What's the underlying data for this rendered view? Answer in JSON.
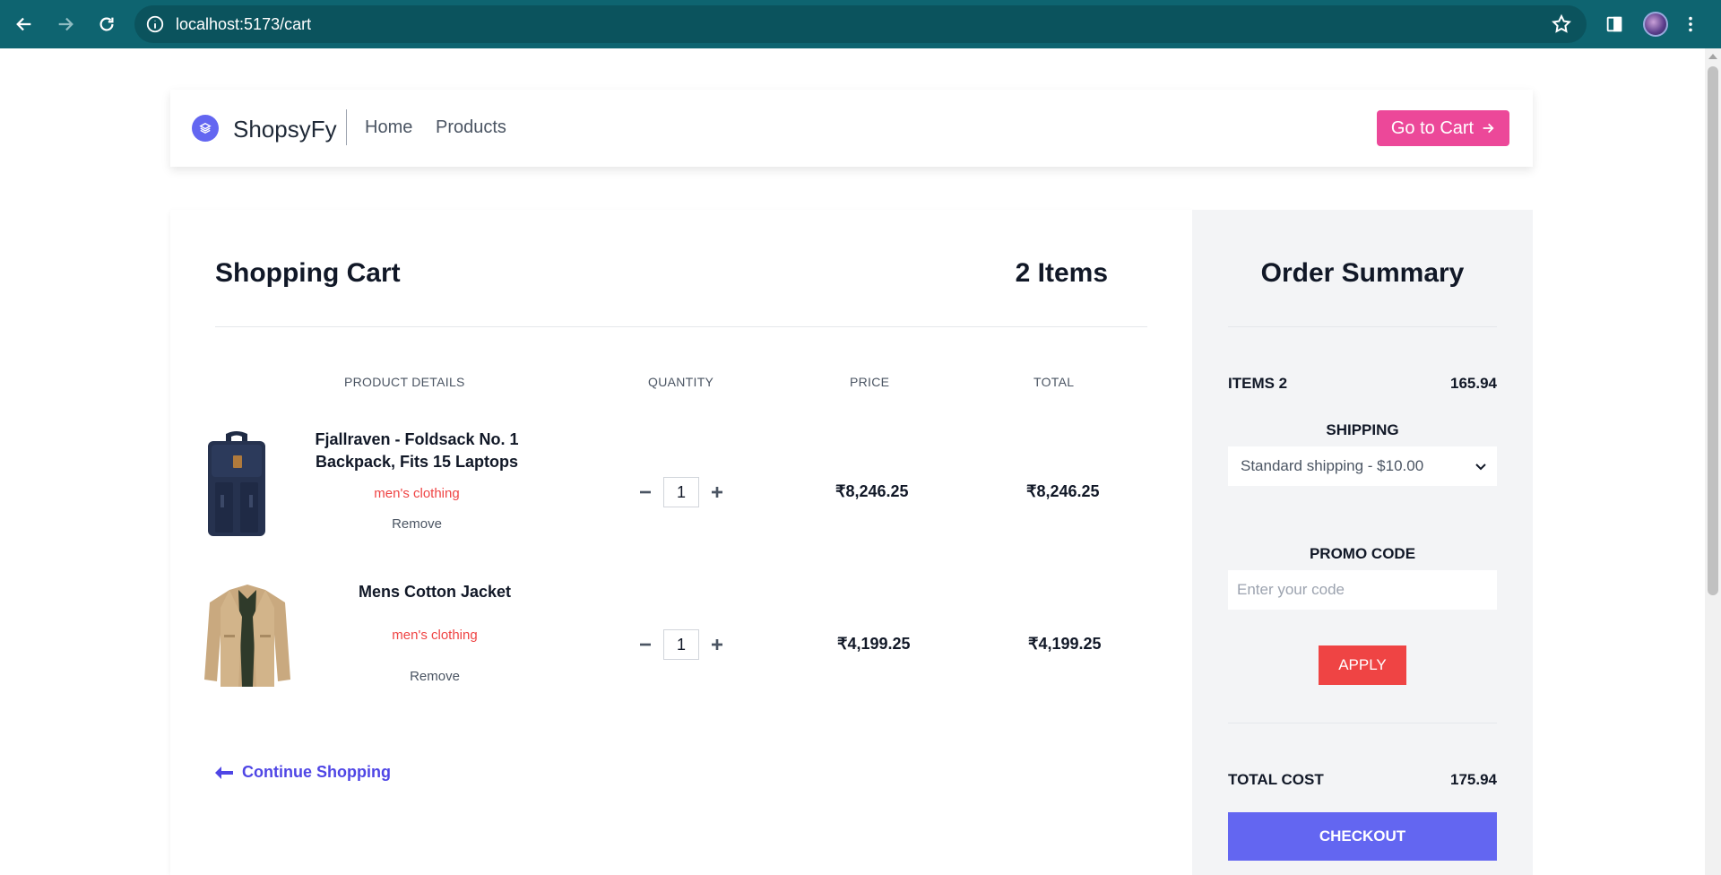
{
  "browser": {
    "url": "localhost:5173/cart",
    "icons": [
      "back-icon",
      "forward-icon",
      "reload-icon",
      "info-icon",
      "star-icon",
      "side-panel-icon",
      "profile-avatar",
      "menu-icon"
    ]
  },
  "navbar": {
    "brand": "ShopsyFy",
    "links": [
      "Home",
      "Products"
    ],
    "cart_button": "Go to Cart"
  },
  "cart": {
    "title": "Shopping Cart",
    "count_label": "2 Items",
    "headers": [
      "PRODUCT DETAILS",
      "QUANTITY",
      "PRICE",
      "TOTAL"
    ],
    "items": [
      {
        "name": "Fjallraven - Foldsack No. 1 Backpack, Fits 15 Laptops",
        "category": "men's clothing",
        "remove": "Remove",
        "quantity": "1",
        "price": "₹8,246.25",
        "total": "₹8,246.25"
      },
      {
        "name": "Mens Cotton Jacket",
        "category": "men's clothing",
        "remove": "Remove",
        "quantity": "1",
        "price": "₹4,199.25",
        "total": "₹4,199.25"
      }
    ],
    "continue": "Continue Shopping"
  },
  "summary": {
    "title": "Order Summary",
    "items_label": "ITEMS 2",
    "items_value": "165.94",
    "shipping_label": "SHIPPING",
    "shipping_selected": "Standard shipping - $10.00",
    "promo_label": "PROMO CODE",
    "promo_placeholder": "Enter your code",
    "apply": "APPLY",
    "total_label": "TOTAL COST",
    "total_value": "175.94",
    "checkout": "CHECKOUT"
  },
  "colors": {
    "browser_bar": "#0e6470",
    "accent_pink": "#ec4899",
    "indigo": "#6366f1",
    "red": "#ef4444"
  }
}
